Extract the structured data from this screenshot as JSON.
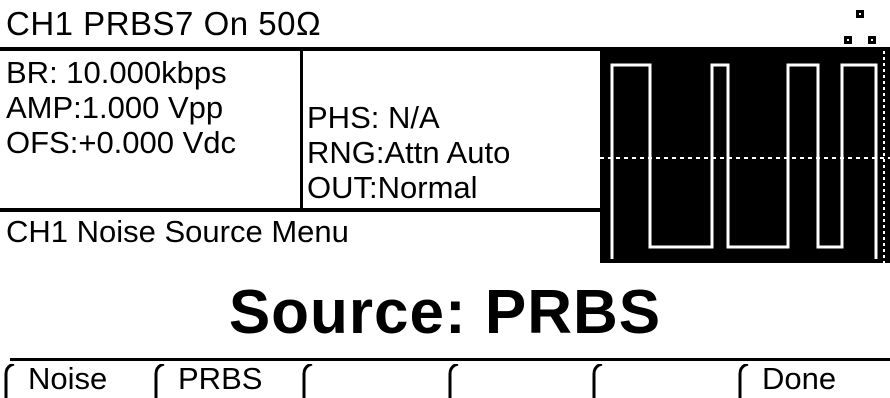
{
  "header": {
    "status_text": "CH1   PRBS7 On 50Ω",
    "menu_icon": "grid-icon"
  },
  "status": {
    "left": [
      "BR:  10.000kbps",
      "AMP:1.000 Vpp",
      "OFS:+0.000 Vdc"
    ],
    "middle": [
      "PHS:  N/A",
      "RNG:Attn Auto",
      "OUT:Normal"
    ]
  },
  "waveform": {
    "type": "PRBS square wave"
  },
  "menu": {
    "title": "CH1 Noise Source Menu",
    "source_readout": "Source: PRBS"
  },
  "softkeys": [
    "Noise",
    "PRBS",
    "",
    "",
    "",
    "Done"
  ]
}
